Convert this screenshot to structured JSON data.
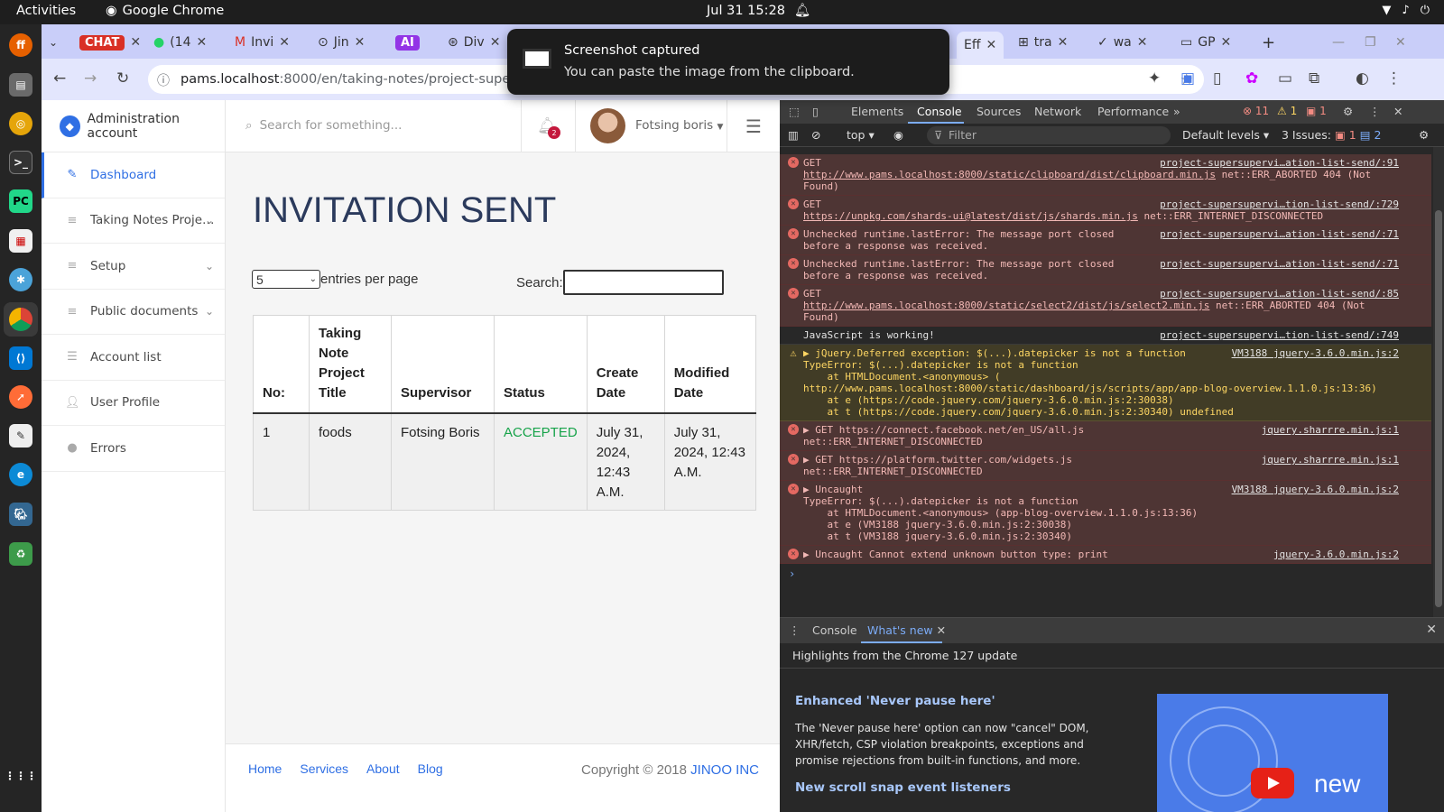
{
  "system": {
    "activities": "Activities",
    "app_name": "Google Chrome",
    "clock": "Jul 31  15:28"
  },
  "browser": {
    "tabs": [
      {
        "label": "CHAT",
        "badge_color": "#d93025"
      },
      {
        "label": "(14"
      },
      {
        "label": "Invi"
      },
      {
        "label": "Jin"
      },
      {
        "label": "AI",
        "badge_color": "#9334e6"
      },
      {
        "label": "Div"
      },
      {
        "label": "Eff"
      },
      {
        "label": "tra"
      },
      {
        "label": "wa"
      },
      {
        "label": "GP"
      }
    ],
    "url_host": "pams.localhost",
    "url_path": ":8000/en/taking-notes/project-supersuperv"
  },
  "toast": {
    "title": "Screenshot captured",
    "body": "You can paste the image from the clipboard."
  },
  "app": {
    "brand": "Administration account",
    "nav": [
      {
        "label": "Dashboard",
        "icon": "pencil-icon",
        "active": true
      },
      {
        "label": "Taking Notes Proje…",
        "icon": "list-icon",
        "chevron": true
      },
      {
        "label": "Setup",
        "icon": "list-icon",
        "chevron": true
      },
      {
        "label": "Public documents",
        "icon": "list-icon",
        "chevron": true
      },
      {
        "label": "Account list",
        "icon": "list-icon"
      },
      {
        "label": "User Profile",
        "icon": "user-icon"
      },
      {
        "label": "Errors",
        "icon": "error-icon"
      }
    ],
    "header": {
      "search_placeholder": "Search for something...",
      "notification_count": "2",
      "user_name": "Fotsing boris"
    },
    "page_title": "INVITATION SENT",
    "entries": {
      "value": "5",
      "label": "entries per page"
    },
    "search_label": "Search:",
    "table": {
      "headers": [
        "No:",
        "Taking Note Project Title",
        "Supervisor",
        "Status",
        "Create Date",
        "Modified Date"
      ],
      "rows": [
        [
          "1",
          "foods",
          "Fotsing Boris",
          "ACCEPTED",
          "July 31, 2024, 12:43 A.M.",
          "July 31, 2024, 12:43 A.M."
        ]
      ]
    },
    "footer": {
      "links": [
        "Home",
        "Services",
        "About",
        "Blog"
      ],
      "copyright": "Copyright © 2018 ",
      "company": "JINOO INC"
    }
  },
  "devtools": {
    "tabs": [
      "Elements",
      "Console",
      "Sources",
      "Network",
      "Performance"
    ],
    "counts": {
      "errors": "11",
      "warnings": "1",
      "issues_top": "1"
    },
    "filter": {
      "context": "top",
      "placeholder": "Filter",
      "levels": "Default levels",
      "issues": "3 Issues:",
      "issue_err": "1",
      "issue_info": "2"
    },
    "messages": [
      {
        "type": "err",
        "text": "GET",
        "link": "http://www.pams.localhost:8000/static/clipboard/dist/clipboard.min.js",
        "tail": " net::ERR_ABORTED 404 (Not\nFound)",
        "src": "project-supersupervi…ation-list-send/:91"
      },
      {
        "type": "err",
        "text": "GET",
        "link": "https://unpkg.com/shards-ui@latest/dist/js/shards.min.js",
        "tail": " net::ERR_INTERNET_DISCONNECTED",
        "src": "project-supersupervi…tion-list-send/:729"
      },
      {
        "type": "err",
        "text": "Unchecked runtime.lastError: The message port closed\nbefore a response was received.",
        "src": "project-supersupervi…ation-list-send/:71"
      },
      {
        "type": "err",
        "text": "Unchecked runtime.lastError: The message port closed\nbefore a response was received.",
        "src": "project-supersupervi…ation-list-send/:71"
      },
      {
        "type": "err",
        "text": "GET",
        "link": "http://www.pams.localhost:8000/static/select2/dist/js/select2.min.js",
        "tail": " net::ERR_ABORTED 404 (Not\nFound)",
        "src": "project-supersupervi…ation-list-send/:85"
      },
      {
        "type": "info",
        "text": "JavaScript is working!",
        "src": "project-supersupervi…tion-list-send/:749"
      },
      {
        "type": "warn",
        "text": "▶ jQuery.Deferred exception: $(...).datepicker is not a function\nTypeError: $(...).datepicker is not a function\n    at HTMLDocument.<anonymous> (\nhttp://www.pams.localhost:8000/static/dashboard/js/scripts/app/app-blog-overview.1.1.0.js:13:36)\n    at e (https://code.jquery.com/jquery-3.6.0.min.js:2:30038)\n    at t (https://code.jquery.com/jquery-3.6.0.min.js:2:30340) undefined",
        "src": "VM3188 jquery-3.6.0.min.js:2"
      },
      {
        "type": "err",
        "text": "▶ GET https://connect.facebook.net/en_US/all.js\nnet::ERR_INTERNET_DISCONNECTED",
        "src": "jquery.sharrre.min.js:1"
      },
      {
        "type": "err",
        "text": "▶ GET https://platform.twitter.com/widgets.js\nnet::ERR_INTERNET_DISCONNECTED",
        "src": "jquery.sharrre.min.js:1"
      },
      {
        "type": "err",
        "text": "▶ Uncaught\nTypeError: $(...).datepicker is not a function\n    at HTMLDocument.<anonymous> (app-blog-overview.1.1.0.js:13:36)\n    at e (VM3188 jquery-3.6.0.min.js:2:30038)\n    at t (VM3188 jquery-3.6.0.min.js:2:30340)",
        "src": "VM3188 jquery-3.6.0.min.js:2"
      },
      {
        "type": "err",
        "text": "▶ Uncaught Cannot extend unknown button type: print",
        "src": "jquery-3.6.0.min.js:2"
      }
    ],
    "drawer": {
      "tabs": [
        "Console",
        "What's new"
      ],
      "headline": "Highlights from the Chrome 127 update",
      "h2": "Enhanced 'Never pause here'",
      "para": "The 'Never pause here' option can now \"cancel\" DOM, XHR/fetch, CSP violation breakpoints, exceptions and promise rejections from built-in functions, and more.",
      "h3": "New scroll snap event listeners",
      "art_text": "new"
    }
  }
}
